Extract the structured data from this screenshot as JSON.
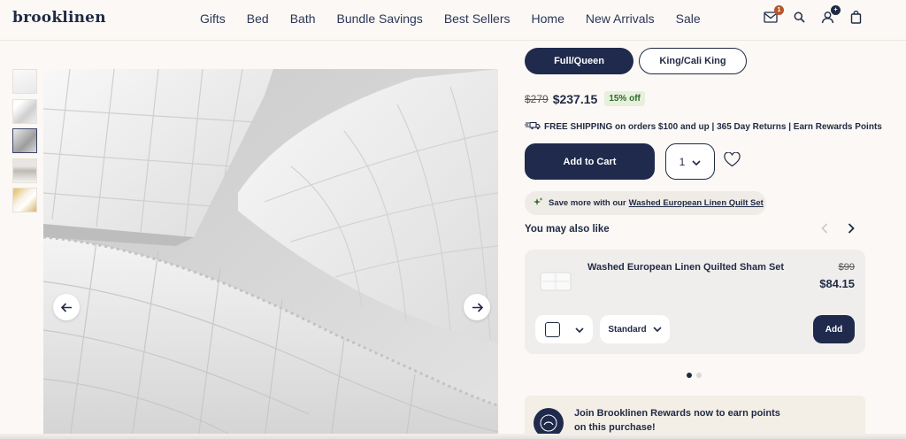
{
  "brand": {
    "logo_text": "brooklinen"
  },
  "nav": {
    "items": [
      "Gifts",
      "Bed",
      "Bath",
      "Bundle Savings",
      "Best Sellers",
      "Home",
      "New Arrivals",
      "Sale"
    ]
  },
  "header_icons": {
    "mail_badge": "1",
    "account_badge": "+",
    "icons": [
      "mail-icon",
      "search-icon",
      "account-icon",
      "bag-icon"
    ]
  },
  "gallery": {
    "thumbnail_count": 5,
    "active_index": 2,
    "prev_icon": "arrow-left-icon",
    "next_icon": "arrow-right-icon"
  },
  "sizes": {
    "selected": "Full/Queen",
    "other": "King/Cali King"
  },
  "price": {
    "original": "$279",
    "current": "$237.15",
    "discount_badge": "15% off"
  },
  "shipping": {
    "icon": "truck-icon",
    "text_bold": "FREE SHIPPING",
    "text_rest": " on orders $100 and up | 365 Day Returns | Earn Rewards Points"
  },
  "cart": {
    "add_label": "Add to Cart",
    "quantity": "1"
  },
  "upsell": {
    "icon": "sparkle-icon",
    "text": "Save more with our",
    "link": "Washed European Linen Quilt Set"
  },
  "recommendations": {
    "heading": "You may also like",
    "item": {
      "title": "Washed European Linen Quilted Sham Set",
      "original_price": "$99",
      "price": "$84.15",
      "option_select": "Standard",
      "add_label": "Add"
    },
    "dots": 2,
    "active_dot": 0
  },
  "rewards": {
    "text": "Join Brooklinen Rewards now to earn points on this purchase!"
  },
  "colors": {
    "navy": "#1f2a4d",
    "background": "#fbf8f5",
    "badge_green_bg": "#e6f0dc",
    "mail_badge": "#b5562a",
    "account_badge": "#1f2a44"
  }
}
